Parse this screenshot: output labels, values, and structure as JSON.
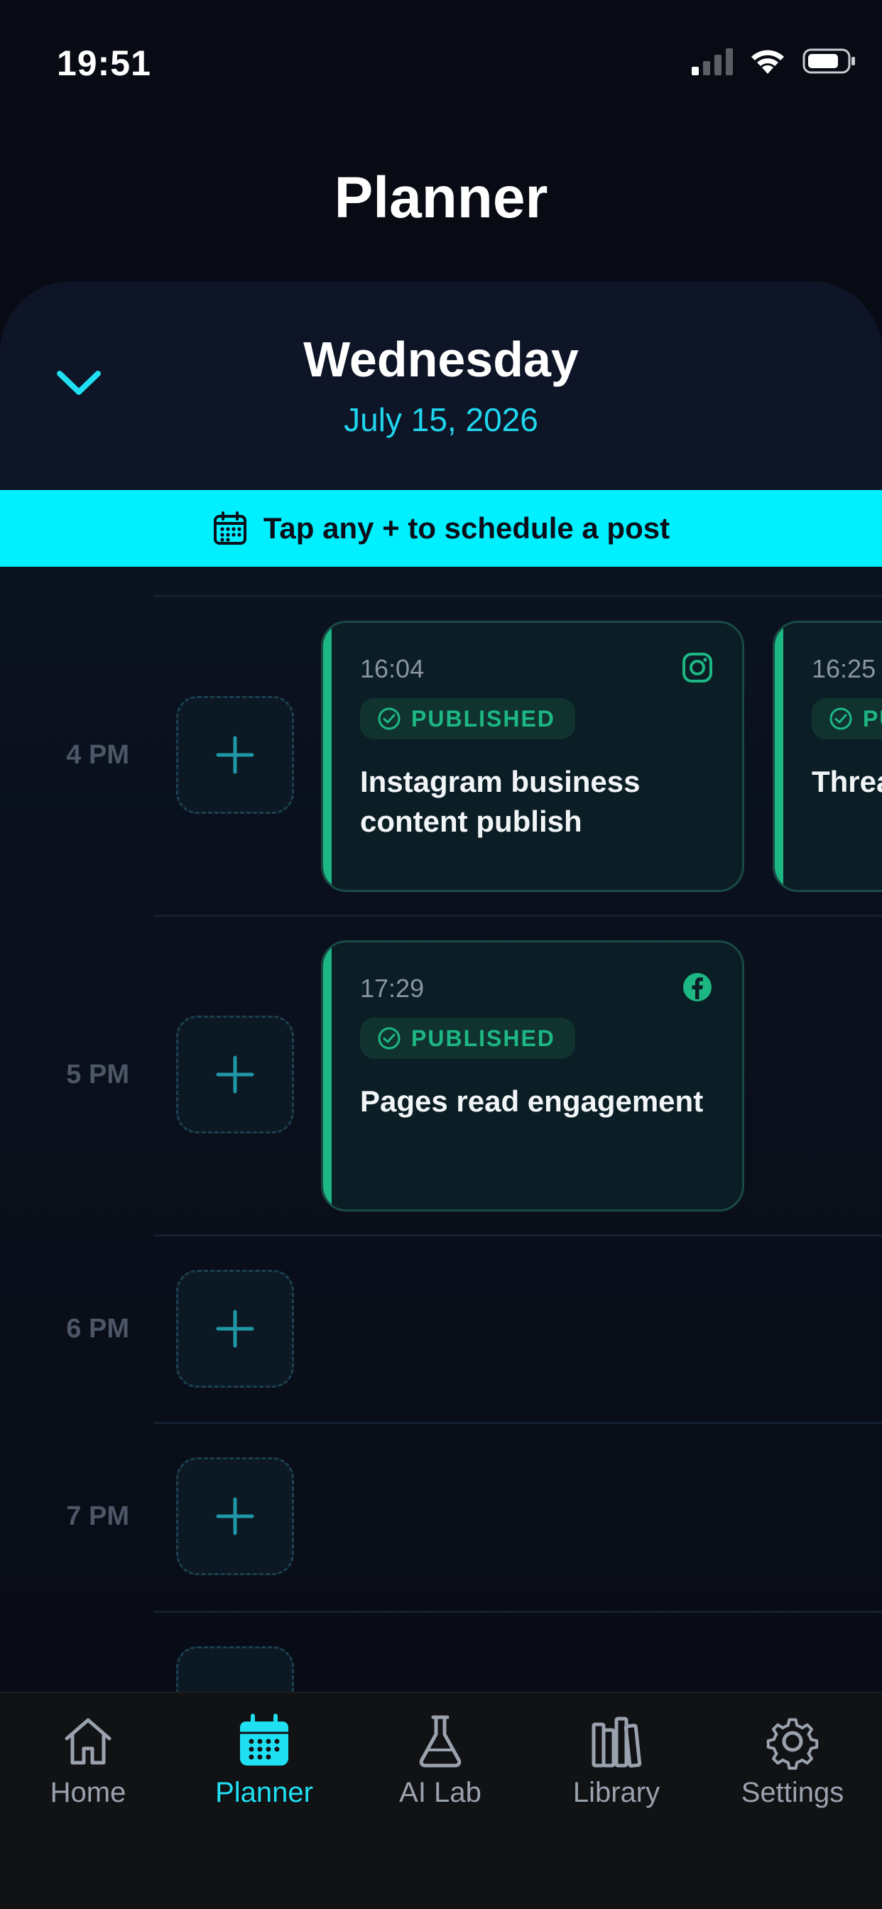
{
  "status_bar": {
    "time": "19:51"
  },
  "header": {
    "title": "Planner"
  },
  "day": {
    "name": "Wednesday",
    "date": "July 15, 2026"
  },
  "tip": {
    "text": "Tap any + to schedule a post"
  },
  "timeline": {
    "hours": [
      "4 PM",
      "5 PM",
      "6 PM",
      "7 PM"
    ],
    "posts": [
      {
        "time": "16:04",
        "status": "PUBLISHED",
        "title": "Instagram business content publish",
        "platform": "instagram-icon"
      },
      {
        "time": "16:25",
        "status": "PUBLISHED",
        "title": "Threads content publish",
        "platform": "threads-icon"
      },
      {
        "time": "17:29",
        "status": "PUBLISHED",
        "title": "Pages read engagement",
        "platform": "facebook-icon"
      }
    ]
  },
  "tabs": [
    {
      "label": "Home",
      "icon": "home-icon",
      "active": false
    },
    {
      "label": "Planner",
      "icon": "calendar-icon",
      "active": true
    },
    {
      "label": "AI Lab",
      "icon": "flask-icon",
      "active": false
    },
    {
      "label": "Library",
      "icon": "library-icon",
      "active": false
    },
    {
      "label": "Settings",
      "icon": "gear-icon",
      "active": false
    }
  ],
  "colors": {
    "accent": "#00f0ff",
    "published": "#1db783",
    "background": "#080b14"
  }
}
